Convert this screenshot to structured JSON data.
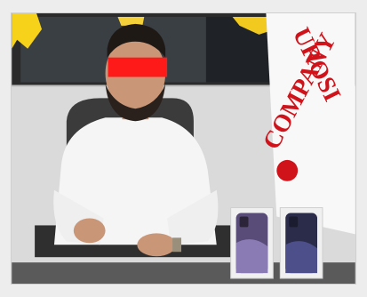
{
  "photo": {
    "description_visible_text_only": true,
    "banner_text": "UROSI COMPANY",
    "colors": {
      "banner_red": "#d0131a",
      "redaction": "#ff1a1a",
      "shirt": "#f4f4f4",
      "wall": "#d7d7d7",
      "chair": "#3a3a3a"
    }
  }
}
